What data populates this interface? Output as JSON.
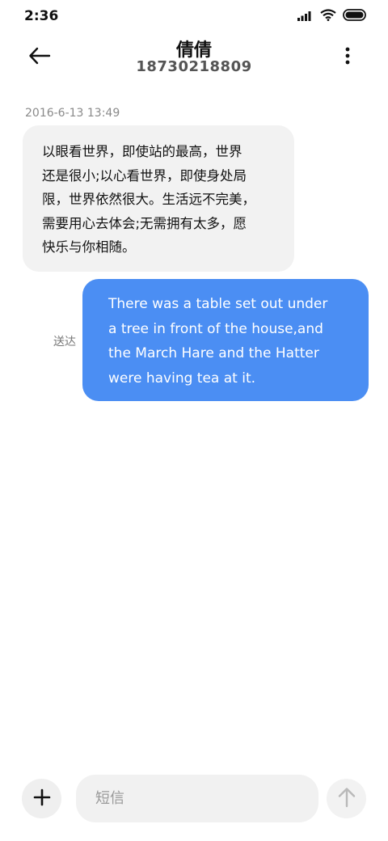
{
  "status_bar": {
    "time": "2:36"
  },
  "header": {
    "contact_name": "倩倩",
    "phone_number": "18730218809"
  },
  "conversation": {
    "timestamp": "2016-6-13 13:49",
    "messages": [
      {
        "direction": "incoming",
        "lines": [
          "以眼看世界，即使站的最高，世界",
          "还是很小;以心看世界，即使身处局",
          "限，世界依然很大。生活远不完美，",
          "需要用心去体会;无需拥有太多，愿",
          "快乐与你相随。"
        ]
      },
      {
        "direction": "outgoing",
        "status": "送达",
        "lines": [
          "There was a table set out under",
          "a tree in front of the house,and",
          "the March Hare and the Hatter",
          "were having tea at it."
        ]
      }
    ]
  },
  "composer": {
    "placeholder": "短信",
    "value": ""
  },
  "icons": {
    "back": "arrow-left-icon",
    "more": "more-vertical-icon",
    "add": "plus-icon",
    "send": "arrow-up-icon",
    "signal": "signal-icon",
    "wifi": "wifi-icon",
    "battery": "battery-icon"
  },
  "colors": {
    "outgoing_bubble": "#4b8ef3",
    "incoming_bubble": "#f2f2f2",
    "input_bg": "#f1f1f1"
  }
}
